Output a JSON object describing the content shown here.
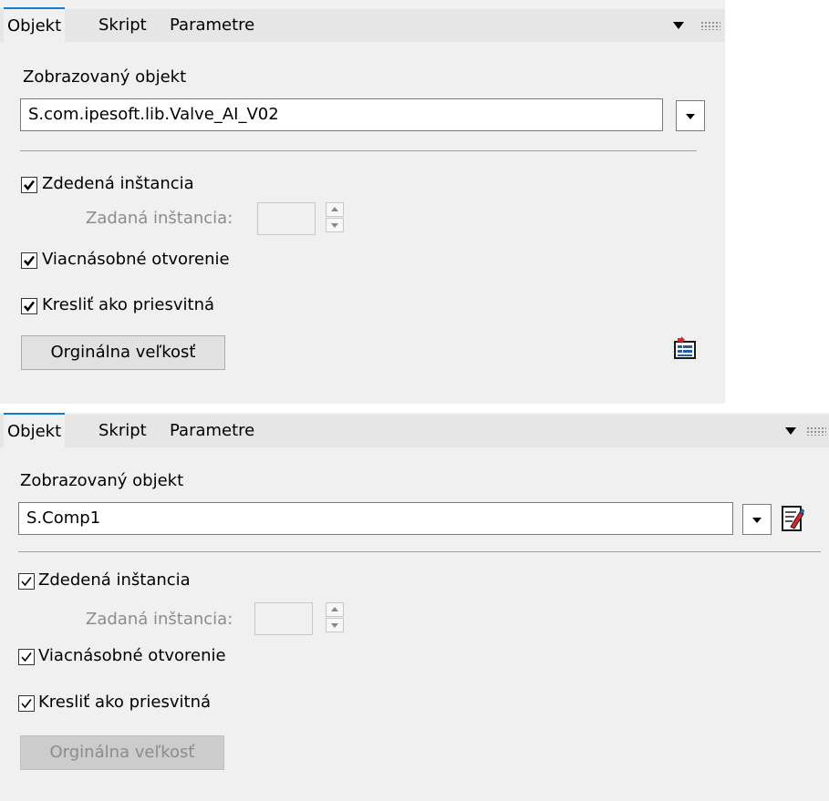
{
  "tabs": [
    "Objekt",
    "Skript",
    "Parametre"
  ],
  "colors": {
    "accent": "#0f7dd4",
    "panel_bg": "#f0f0f0",
    "tabbar_bg": "#e6e6e6",
    "disabled_text": "#8c8c8c"
  },
  "panels": [
    {
      "active_tab": "Objekt",
      "object_label": "Zobrazovaný objekt",
      "object_value": "S.com.ipesoft.lib.Valve_AI_V02",
      "inherited_instance": {
        "label": "Zdedená inštancia",
        "checked": true
      },
      "given_instance": {
        "label": "Zadaná inštancia:",
        "value": "",
        "enabled": false
      },
      "multiple_open": {
        "label": "Viacnásobné otvorenie",
        "checked": true
      },
      "draw_transparent": {
        "label": "Kresliť ako priesvitná",
        "checked": true
      },
      "original_size_button": {
        "label": "Orginálna veľkosť",
        "enabled": true
      },
      "icons": [
        "dropdown-arrow-icon",
        "properties-icon"
      ]
    },
    {
      "active_tab": "Objekt",
      "object_label": "Zobrazovaný objekt",
      "object_value": "S.Comp1",
      "inherited_instance": {
        "label": "Zdedená inštancia",
        "checked": true
      },
      "given_instance": {
        "label": "Zadaná inštancia:",
        "value": "",
        "enabled": false
      },
      "multiple_open": {
        "label": "Viacnásobné otvorenie",
        "checked": true
      },
      "draw_transparent": {
        "label": "Kresliť ako priesvitná",
        "checked": true
      },
      "original_size_button": {
        "label": "Orginálna veľkosť",
        "enabled": false
      },
      "icons": [
        "dropdown-arrow-icon",
        "edit-document-icon"
      ]
    }
  ]
}
